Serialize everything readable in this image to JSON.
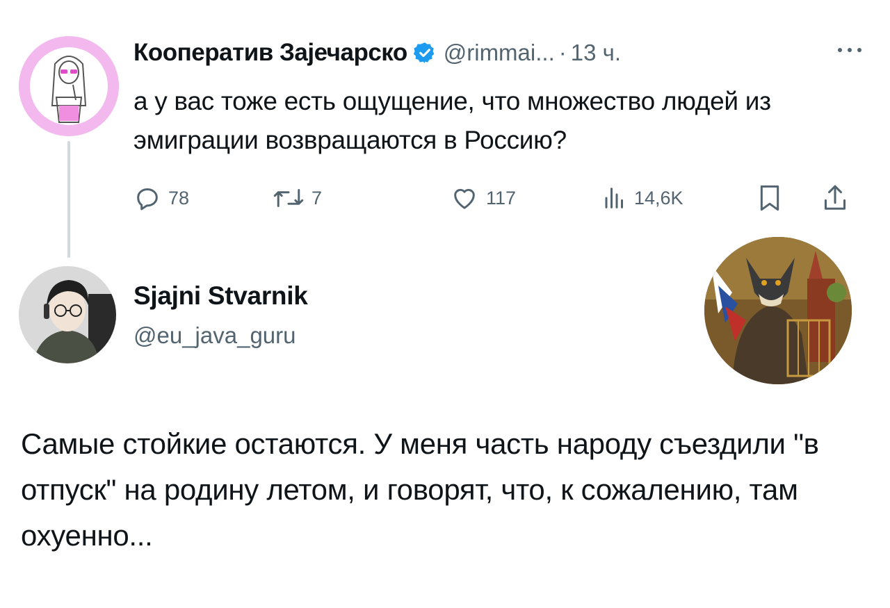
{
  "tweet1": {
    "author_name": "Кооператив Зајечарско",
    "verified_icon": "verified-badge-icon",
    "handle": "@rimmai...",
    "separator": "·",
    "time": "13 ч.",
    "more_icon": "more-dots-icon",
    "text": "а у вас тоже есть ощущение, что множество людей из эмиграции возвращаются в Россию?",
    "actions": {
      "replies": "78",
      "retweets": "7",
      "likes": "117",
      "views": "14,6K"
    },
    "avatar_icon": "girl-sketch-avatar"
  },
  "tweet2": {
    "author_name": "Sjajni Stvarnik",
    "handle": "@eu_java_guru",
    "avatar_icon": "anime-guy-avatar",
    "side_image_icon": "wolf-painting-avatar",
    "text": "Самые стойкие остаются. У меня часть народу съездили \"в отпуск\" на родину летом, и говорят, что, к сожалению, там охуенно..."
  },
  "colors": {
    "text": "#0f1419",
    "secondary": "#536471",
    "verified": "#1d9bf0",
    "thread_line": "#cfd9de",
    "avatar1_bg": "#f3b8ee"
  }
}
